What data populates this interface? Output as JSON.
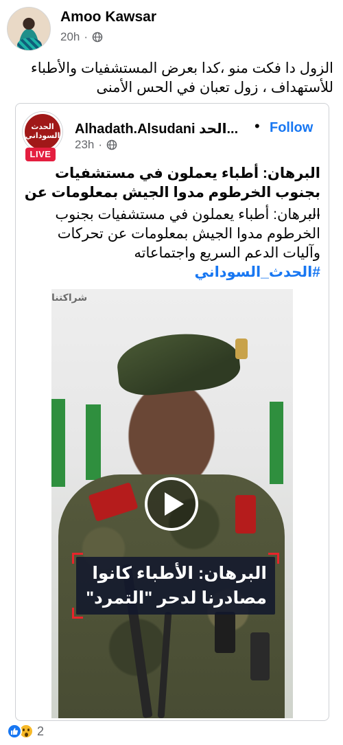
{
  "post": {
    "author": "Amoo Kawsar",
    "time": "20h",
    "separator": "·",
    "audience_icon": "globe-icon",
    "text": "الزول دا فكت منو ،كدا بعرض المستشفيات والأطباء للأستهداف ، زول تعبان في الحس الأمنى"
  },
  "shared": {
    "logo_text_top": "الحدث",
    "logo_text_bottom": "السوداني",
    "live_label": "LIVE",
    "page_name": "Alhadath.Alsudani الحد...",
    "separator": "•",
    "follow_label": "Follow",
    "time": "23h",
    "time_separator": "·",
    "audience_icon": "globe-icon",
    "headline": "البرهان: أطباء يعملون في مستشفيات بجنوب الخرطوم مدوا الجيش بمعلومات عن ...",
    "body": "البرهان: أطباء يعملون في مستشفيات بجنوب الخرطوم مدوا الجيش بمعلومات عن تحركات وآليات الدعم السريع واجتماعاته",
    "hashtag": "#الحدث_السوداني"
  },
  "video": {
    "watermark": "شراكتنا",
    "caption_line1": "البرهان: الأطباء كانوا",
    "caption_line2": "مصادرنا لدحر \"التمرد\"",
    "play_icon": "play-icon"
  },
  "reactions": {
    "icons": [
      "like-icon",
      "wow-icon"
    ],
    "count": "2"
  },
  "colors": {
    "accent": "#1877f2",
    "live": "#e41e3f",
    "muted": "#65676b"
  }
}
